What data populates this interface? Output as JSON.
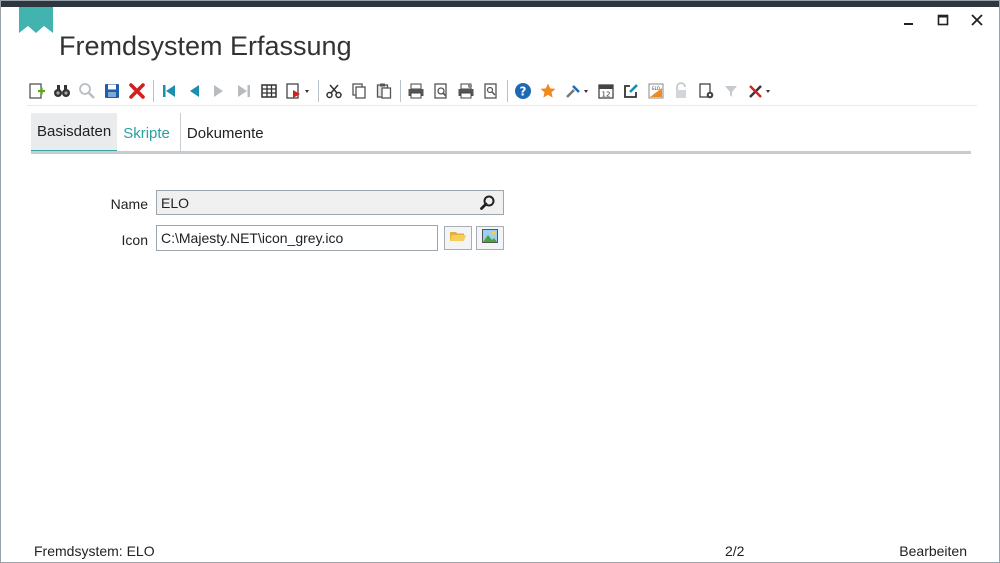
{
  "window": {
    "title": "Fremdsystem Erfassung",
    "controls": {
      "minimize": "‗",
      "maximize": "☐",
      "close": "✕"
    },
    "accent": "#3aa5a5"
  },
  "toolbar": {
    "items": [
      "new-record-icon",
      "find-icon",
      "search-icon",
      "save-icon",
      "delete-icon",
      "first-record-icon",
      "previous-record-icon",
      "next-record-icon",
      "last-record-icon",
      "table-view-icon",
      "export-dropdown-icon",
      "cut-icon",
      "copy-icon",
      "paste-icon",
      "print-icon",
      "print-preview-icon",
      "print-options-icon",
      "page-preview-icon",
      "help-icon",
      "favorite-icon",
      "tools-dropdown-icon",
      "calendar-icon",
      "edit-icon",
      "elo-icon",
      "lock-icon",
      "document-settings-icon",
      "filter-icon",
      "settings-dropdown-icon"
    ]
  },
  "tabs": [
    {
      "label": "Basisdaten",
      "state": "active"
    },
    {
      "label": "Skripte",
      "state": "selected"
    },
    {
      "label": "Dokumente",
      "state": "normal"
    }
  ],
  "form": {
    "name": {
      "label": "Name",
      "value": "ELO"
    },
    "icon": {
      "label": "Icon",
      "value": "C:\\Majesty.NET\\icon_grey.ico"
    }
  },
  "status": {
    "left": "Fremdsystem: ELO",
    "page": "2/2",
    "mode": "Bearbeiten"
  }
}
